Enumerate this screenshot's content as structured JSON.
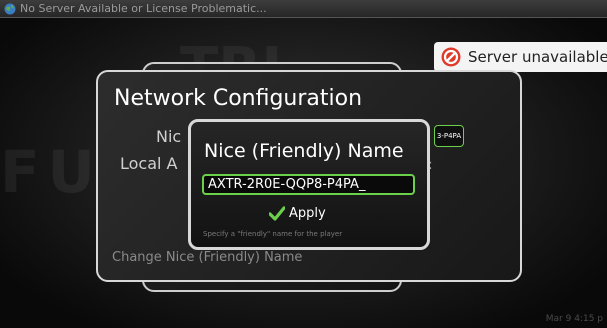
{
  "window": {
    "title": "No Server Available or License Problematic...",
    "icon": "app-globe-icon"
  },
  "background": {
    "watermark_top": "TRI",
    "watermark_row": "FU                                        CH"
  },
  "status": {
    "server_text": "Server unavailable",
    "icon": "no-entry-icon",
    "icon_color": "#e03a2a"
  },
  "panel": {
    "title": "Network Configuration",
    "nice_label": "Nic",
    "nice_value": "3-P4PA",
    "local_label": "Local A",
    "local_value": ":",
    "footer": "Change Nice (Friendly) Name"
  },
  "dialog": {
    "title": "Nice (Friendly) Name",
    "input_value": "AXTR-2R0E-QQP8-P4PA_",
    "apply_label": "Apply",
    "hint": "Specify a \"friendly\" name for the player",
    "accent_color": "#6bd14a"
  },
  "footer": {
    "datetime": "Mar 9  4:15 p"
  }
}
